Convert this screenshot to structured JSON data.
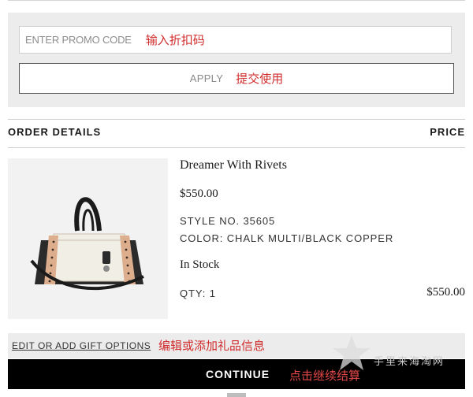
{
  "promo": {
    "placeholder": "ENTER PROMO CODE",
    "placeholder_note": "输入折扣码",
    "apply_label": "APPLY",
    "apply_note": "提交使用"
  },
  "order_table": {
    "col_details": "ORDER DETAILS",
    "col_price": "PRICE"
  },
  "item": {
    "name": "Dreamer With Rivets",
    "price": "$550.00",
    "style": "STYLE NO. 35605",
    "color": "COLOR: CHALK MULTI/BLACK COPPER",
    "stock": "In Stock",
    "qty": "QTY: 1",
    "line_price": "$550.00"
  },
  "gift": {
    "link": "EDIT OR ADD GIFT OPTIONS",
    "note": "编辑或添加礼品信息"
  },
  "checkout": {
    "continue_label": "CONTINUE",
    "continue_note": "点击继续结算"
  },
  "watermark": {
    "text": "手里来海淘网"
  },
  "colors": {
    "annotation_red": "#d12b2b",
    "panel_gray": "#ececec",
    "continue_bg": "#000000"
  }
}
